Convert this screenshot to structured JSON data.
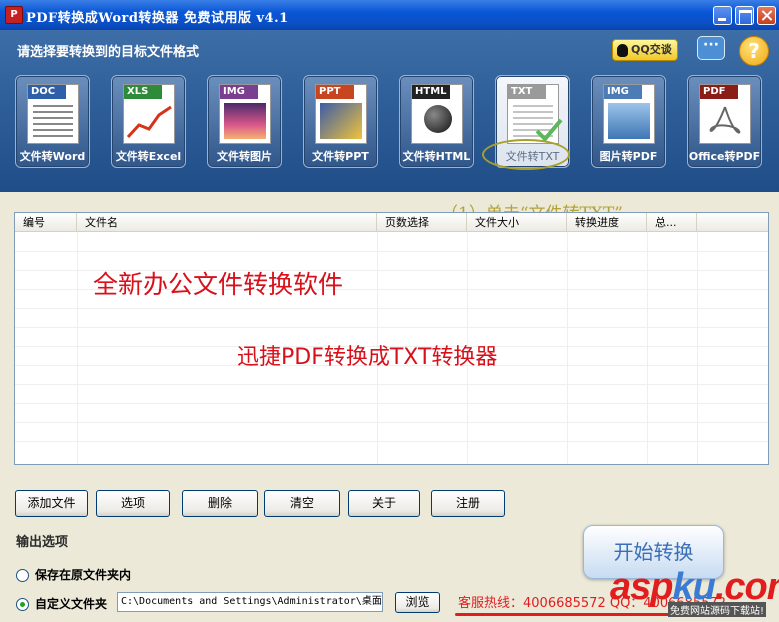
{
  "window": {
    "title": "PDF转换成Word转换器 免费试用版 v4.1"
  },
  "header": {
    "subtitle": "请选择要转换到的目标文件格式",
    "qq_label": "QQ交谈",
    "help_glyph": "?",
    "chat_glyph": "···"
  },
  "formats": [
    {
      "tag": "DOC",
      "label": "文件转Word",
      "color": "#2f5fa8"
    },
    {
      "tag": "XLS",
      "label": "文件转Excel",
      "color": "#2e8b3a"
    },
    {
      "tag": "IMG",
      "label": "文件转图片",
      "color": "#7a3f8f"
    },
    {
      "tag": "PPT",
      "label": "文件转PPT",
      "color": "#c8461f"
    },
    {
      "tag": "HTML",
      "label": "文件转HTML",
      "color": "#222222"
    },
    {
      "tag": "TXT",
      "label": "文件转TXT",
      "color": "#9a9a9a"
    },
    {
      "tag": "IMG",
      "label": "图片转PDF",
      "color": "#4d7bb5"
    },
    {
      "tag": "PDF",
      "label": "Office转PDF",
      "color": "#8a1d16"
    }
  ],
  "step_note": "（1）单击“文件转TXT”",
  "table": {
    "columns": [
      "编号",
      "文件名",
      "页数选择",
      "文件大小",
      "转换进度",
      "总..."
    ]
  },
  "promo": {
    "line1": "全新办公文件转换软件",
    "line2": "迅捷PDF转换成TXT转换器"
  },
  "buttons": [
    "添加文件",
    "选项",
    "删除",
    "清空",
    "关于",
    "注册"
  ],
  "output": {
    "section_label": "输出选项",
    "option1": "保存在原文件夹内",
    "option2": "自定义文件夹",
    "selected": "option2",
    "path": "C:\\Documents and Settings\\Administrator\\桌面",
    "browse": "浏览",
    "hotline": "客服热线：4006685572 QQ：4006685572"
  },
  "start_button": "开始转换",
  "watermark": {
    "main1": "asp",
    "main2": "ku",
    "main3": ".com",
    "sub": "免费网站源码下载站!"
  }
}
